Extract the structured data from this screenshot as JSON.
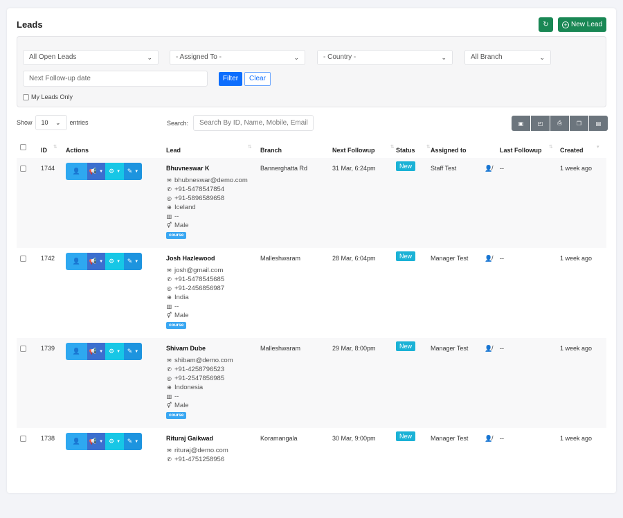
{
  "header": {
    "title": "Leads",
    "refresh_icon": "refresh-icon",
    "new_lead_label": "New Lead"
  },
  "filters": {
    "status_select": "All Open Leads",
    "assigned_select": "- Assigned To -",
    "country_select": "- Country -",
    "branch_select": "All Branch",
    "date_placeholder": "Next Follow-up date",
    "filter_label": "Filter",
    "clear_label": "Clear",
    "my_leads_label": "My Leads Only"
  },
  "table_controls": {
    "show_label": "Show",
    "entries_value": "10",
    "entries_label": "entries",
    "search_label": "Search:",
    "search_placeholder": "Search By ID, Name, Mobile, Email",
    "export_buttons": [
      "excel-icon",
      "pdf-icon",
      "print-icon",
      "copy-icon",
      "csv-icon"
    ]
  },
  "columns": [
    "ID",
    "Actions",
    "Lead",
    "Branch",
    "Next Followup",
    "Status",
    "Assigned to",
    "Last Followup",
    "Created"
  ],
  "rows": [
    {
      "id": "1744",
      "name": "Bhuvneswar K",
      "email": "bhubneswar@demo.com",
      "phone": "+91-5478547854",
      "whatsapp": "+91-5896589658",
      "country": "Iceland",
      "company": "--",
      "gender": "Male",
      "tag": "course",
      "branch": "Bannerghatta Rd",
      "next_followup": "31 Mar, 6:24pm",
      "status": "New",
      "assigned_to": "Staff Test",
      "last_followup": "--",
      "created": "1 week ago"
    },
    {
      "id": "1742",
      "name": "Josh Hazlewood",
      "email": "josh@gmail.com",
      "phone": "+91-5478545685",
      "whatsapp": "+91-2456856987",
      "country": "India",
      "company": "--",
      "gender": "Male",
      "tag": "course",
      "branch": "Malleshwaram",
      "next_followup": "28 Mar, 6:04pm",
      "status": "New",
      "assigned_to": "Manager Test",
      "last_followup": "--",
      "created": "1 week ago"
    },
    {
      "id": "1739",
      "name": "Shivam Dube",
      "email": "shibam@demo.com",
      "phone": "+91-4258796523",
      "whatsapp": "+91-2547856985",
      "country": "Indonesia",
      "company": "--",
      "gender": "Male",
      "tag": "course",
      "branch": "Malleshwaram",
      "next_followup": "29 Mar, 8:00pm",
      "status": "New",
      "assigned_to": "Manager Test",
      "last_followup": "--",
      "created": "1 week ago"
    },
    {
      "id": "1738",
      "name": "Rituraj Gaikwad",
      "email": "rituraj@demo.com",
      "phone": "+91-4751258956",
      "whatsapp": "",
      "country": "",
      "company": "",
      "gender": "",
      "tag": "",
      "branch": "Koramangala",
      "next_followup": "30 Mar, 9:00pm",
      "status": "New",
      "assigned_to": "Manager Test",
      "last_followup": "--",
      "created": "1 week ago"
    }
  ],
  "colors": {
    "primary": "#0d6efd",
    "success": "#198754",
    "status_new": "#1bb2d6",
    "secondary": "#6c757d"
  }
}
